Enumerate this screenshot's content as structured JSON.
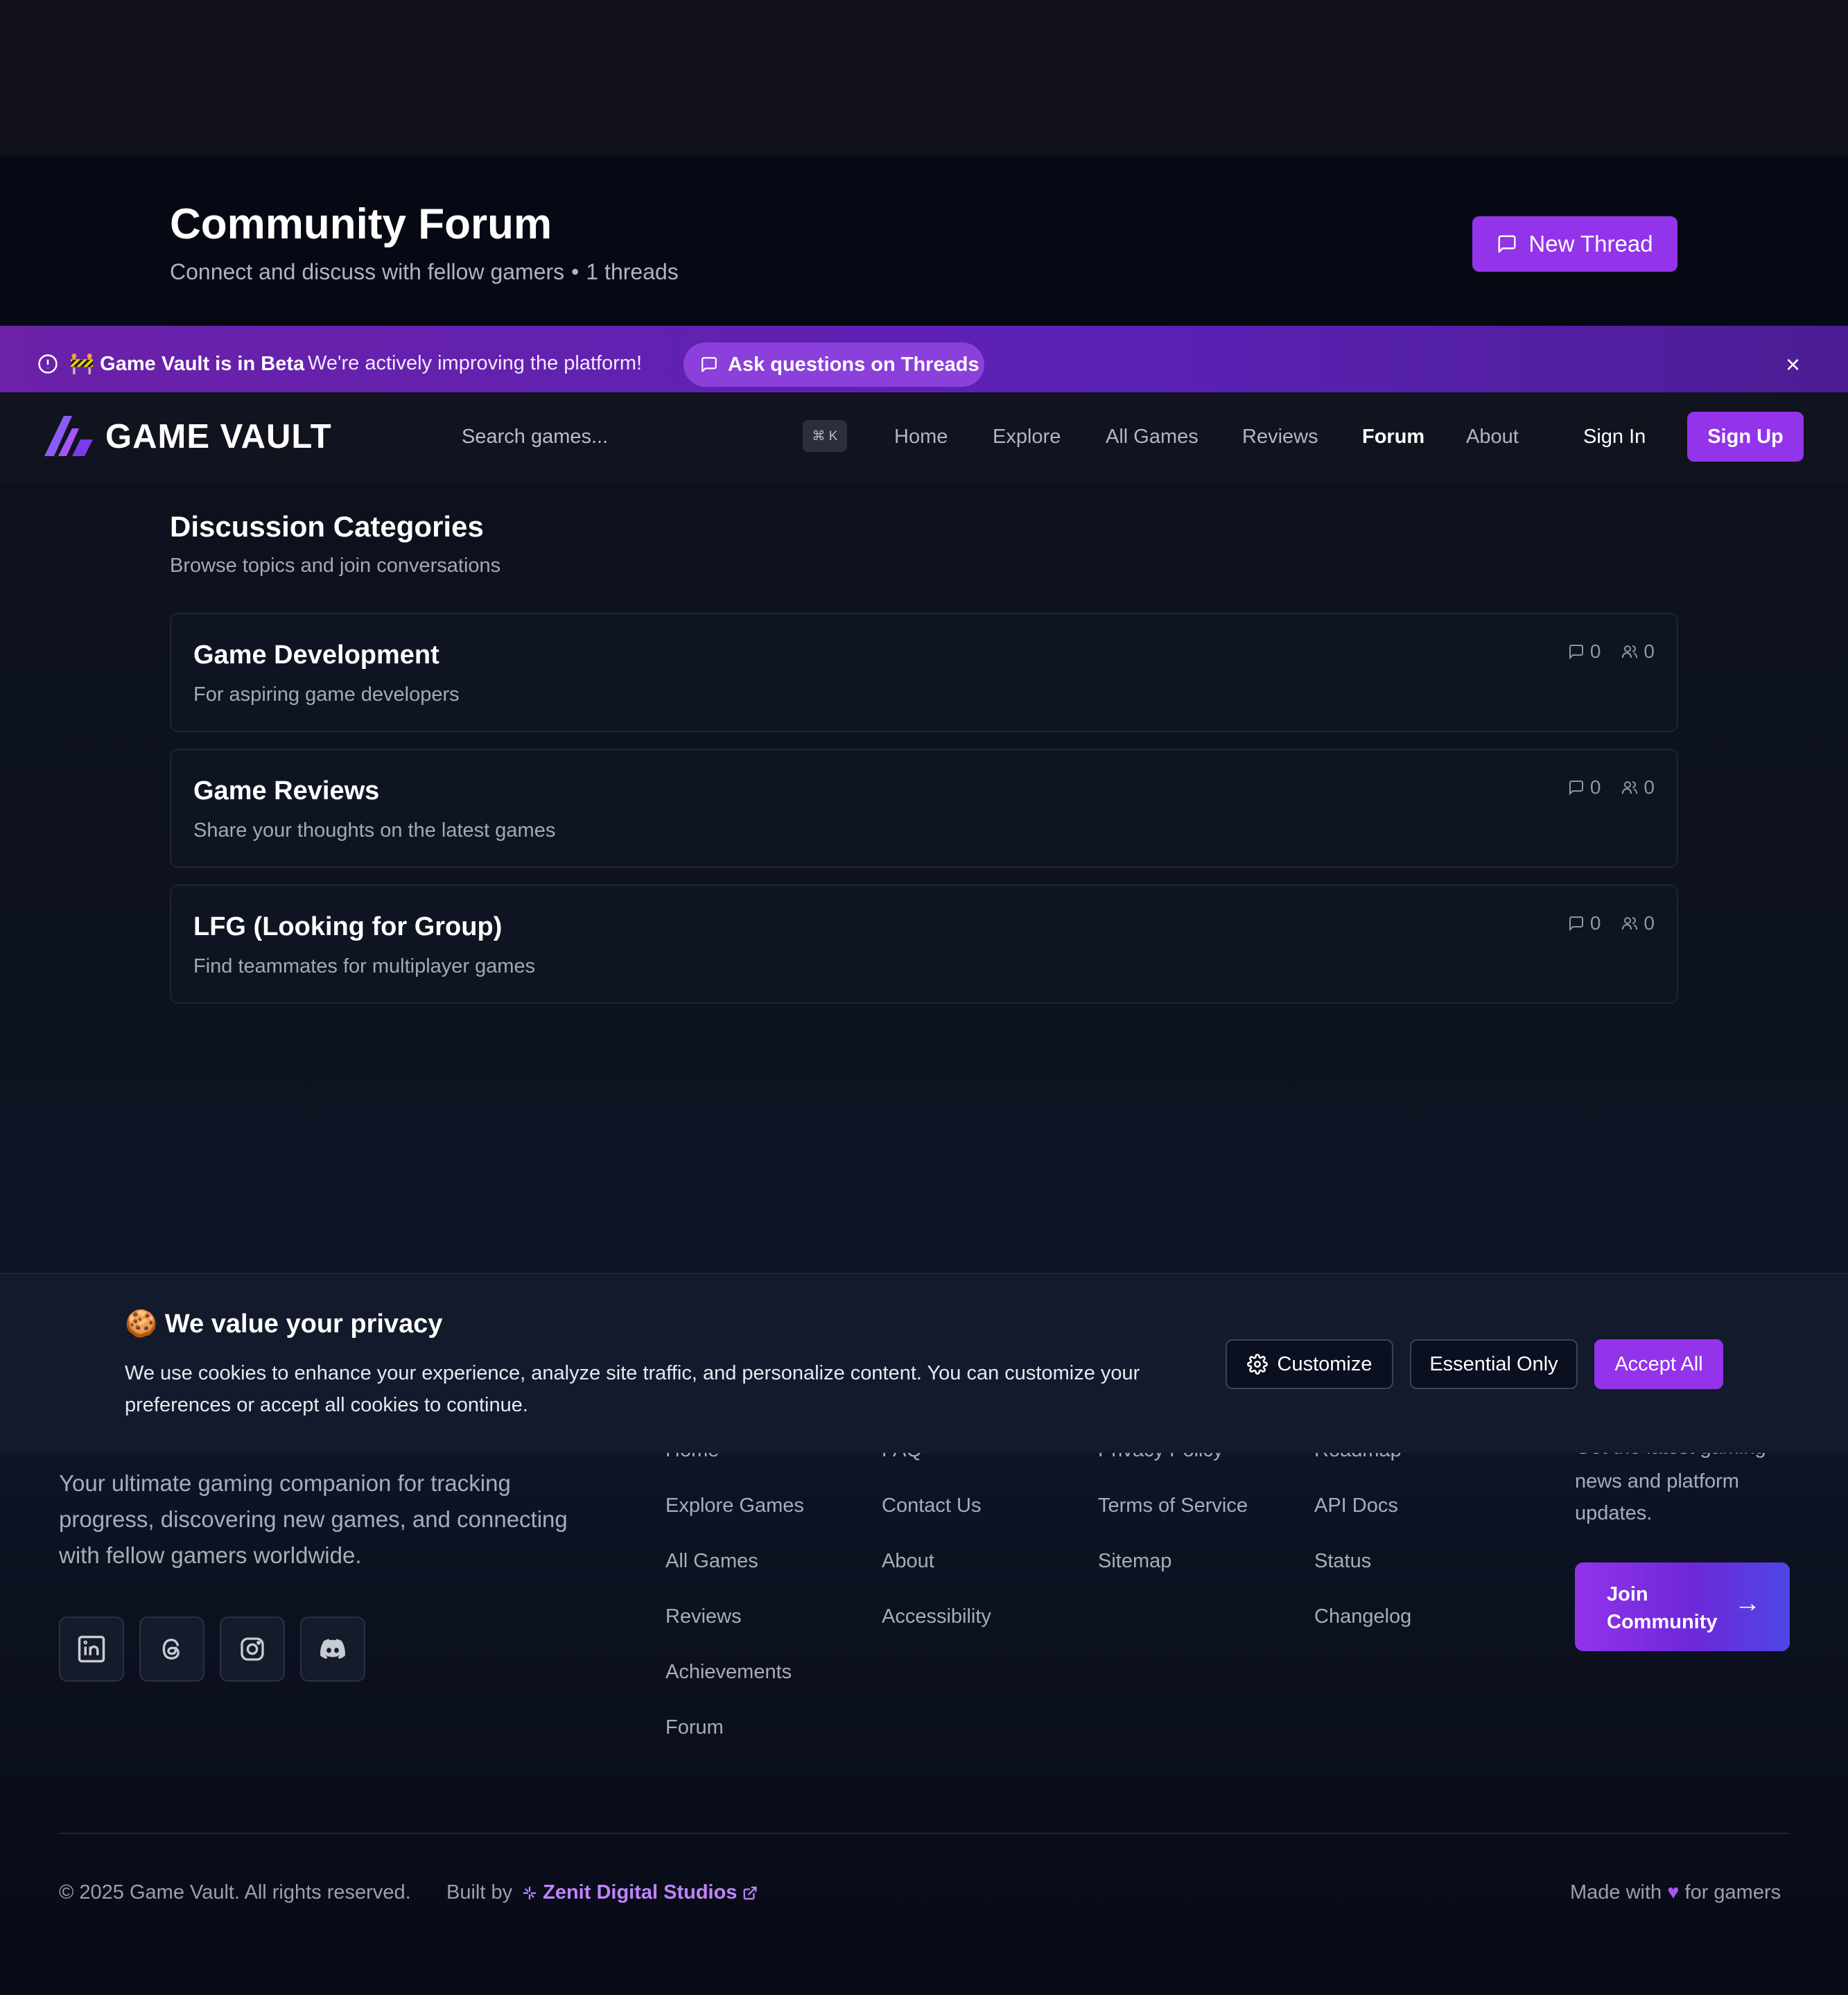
{
  "forum_header": {
    "title": "Community Forum",
    "subtitle": "Connect and discuss with fellow gamers",
    "thread_count": "1 threads",
    "new_thread_label": "New Thread"
  },
  "beta_banner": {
    "title": "🚧 Game Vault is in Beta",
    "text": "We're actively improving the platform!",
    "link_label": "Ask questions on Threads",
    "close_label": "×"
  },
  "nav": {
    "brand": "GAME VAULT",
    "search_placeholder": "Search games...",
    "shortcut": "⌘ K",
    "links": [
      "Home",
      "Explore",
      "All Games",
      "Reviews",
      "Forum",
      "About"
    ],
    "active": "Forum",
    "sign_in": "Sign In",
    "sign_up": "Sign Up"
  },
  "categories": {
    "title": "Discussion Categories",
    "subtitle": "Browse topics and join conversations",
    "items": [
      {
        "title": "Game Development",
        "description": "For aspiring game developers",
        "threads": "0",
        "members": "0"
      },
      {
        "title": "Game Reviews",
        "description": "Share your thoughts on the latest games",
        "threads": "0",
        "members": "0"
      },
      {
        "title": "LFG (Looking for Group)",
        "description": "Find teammates for multiplayer games",
        "threads": "0",
        "members": "0"
      }
    ]
  },
  "cookie": {
    "title": "🍪 We value your privacy",
    "text": "We use cookies to enhance your experience, analyze site traffic, and personalize content. You can customize your preferences or accept all cookies to continue.",
    "customize": "Customize",
    "essential": "Essential Only",
    "accept": "Accept All"
  },
  "footer": {
    "tagline": "Your ultimate gaming companion for tracking progress, discovering new games, and connecting with fellow gamers worldwide.",
    "col1": [
      "Home",
      "Explore Games",
      "All Games",
      "Reviews",
      "Achievements",
      "Forum"
    ],
    "col2": [
      "FAQ",
      "Contact Us",
      "About",
      "Accessibility"
    ],
    "col3": [
      "Privacy Policy",
      "Terms of Service",
      "Sitemap"
    ],
    "col4": [
      "Roadmap",
      "API Docs",
      "Status",
      "Changelog"
    ],
    "newsletter_cut": "Get the latest gaming",
    "newsletter_rest": "news and platform updates.",
    "join_label_1": "Join",
    "join_label_2": "Community",
    "join_arrow": "→",
    "copyright": "© 2025 Game Vault. All rights reserved.",
    "built_by": "Built by",
    "studio": "Zenit Digital Studios",
    "made_with": "Made with",
    "heart": "♥",
    "for_gamers": "for gamers"
  },
  "colors": {
    "accent": "#9333ea",
    "background": "#0b0f1c",
    "beta_banner": "#6b21a8"
  }
}
